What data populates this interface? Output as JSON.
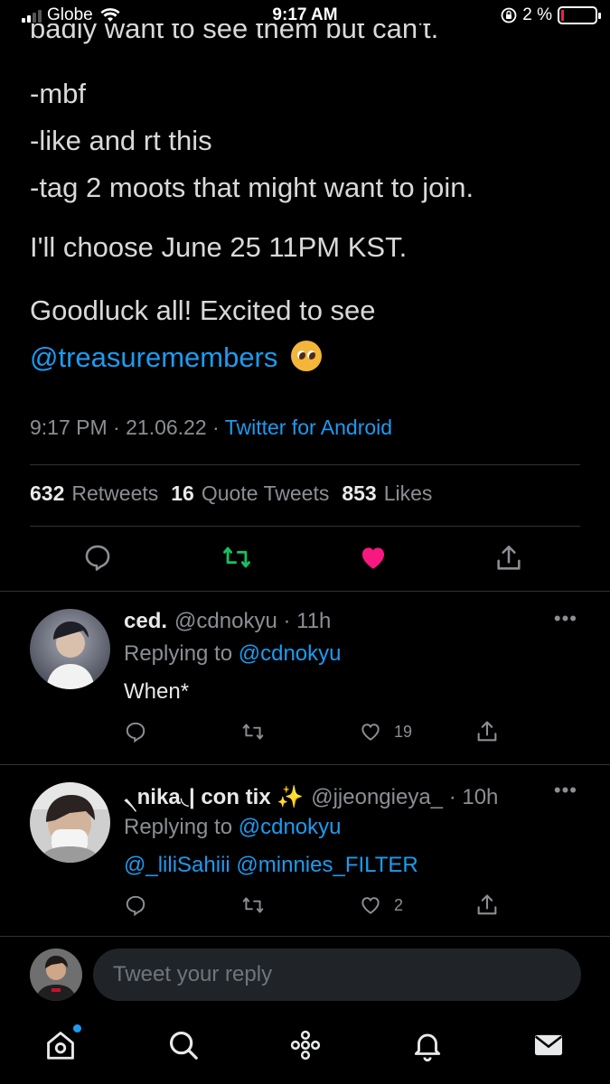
{
  "status_bar": {
    "carrier": "Globe",
    "time": "9:17 AM",
    "battery": "2 %"
  },
  "tweet": {
    "cut_line": "badly want to see them but can't.",
    "lines": [
      "-mbf",
      "-like and rt this",
      "-tag 2 moots that might want to join."
    ],
    "choose_line": "I'll choose June 25 11PM KST.",
    "goodluck_line": "Goodluck all! Excited to see",
    "mention": "@treasuremembers",
    "meta": {
      "time": "9:17 PM",
      "sep": "·",
      "date": "21.06.22",
      "source": "Twitter for Android"
    },
    "stats": {
      "retweets_count": "632",
      "retweets_label": "Retweets",
      "quotes_count": "16",
      "quotes_label": "Quote Tweets",
      "likes_count": "853",
      "likes_label": "Likes"
    }
  },
  "replies": [
    {
      "name": "ced.",
      "handle": "@cdnokyu",
      "time": "· 11h",
      "replying_label": "Replying to",
      "replying_to": "@cdnokyu",
      "text": "When*",
      "likes": "19"
    },
    {
      "name": "৲nika◟| con tix ✨",
      "handle": "@jjeongieya_",
      "time": "· 10h",
      "replying_label": "Replying to",
      "replying_to": "@cdnokyu",
      "text": "@_liliSahiii @minnies_FILTER",
      "likes": "2"
    }
  ],
  "composer": {
    "placeholder": "Tweet your reply"
  },
  "colors": {
    "accent": "#1d9bf0",
    "retweet": "#17bf63",
    "like": "#f91880",
    "background": "#000000"
  }
}
